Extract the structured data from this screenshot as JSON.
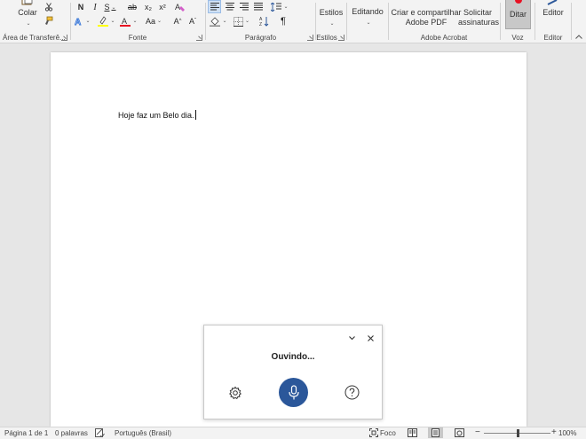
{
  "ribbon": {
    "clipboard": {
      "paste_label": "Colar",
      "group_label": "Área de Transferê..."
    },
    "font": {
      "bold": "N",
      "italic": "I",
      "underline": "S",
      "strike": "ab",
      "subscript": "x₂",
      "superscript": "x²",
      "font_size_grow": "A",
      "font_size_shrink": "A",
      "change_case": "Aa",
      "group_label": "Fonte"
    },
    "paragraph": {
      "group_label": "Parágrafo",
      "pilcrow": "¶"
    },
    "styles": {
      "label": "Estilos",
      "group_label": "Estilos"
    },
    "editing": {
      "label": "Editando"
    },
    "acrobat": {
      "create_pdf_line1": "Criar e compartilhar",
      "create_pdf_line2": "Adobe PDF",
      "request_sign_line1": "Solicitar",
      "request_sign_line2": "assinaturas",
      "group_label": "Adobe Acrobat"
    },
    "voice": {
      "dictate_label": "Ditar",
      "group_label": "Voz"
    },
    "editor": {
      "label": "Editor",
      "group_label": "Editor"
    }
  },
  "document": {
    "body_text": "Hoje faz um Belo dia."
  },
  "dictation_panel": {
    "status": "Ouvindo..."
  },
  "statusbar": {
    "page": "Página 1 de 1",
    "words": "0 palavras",
    "language": "Português (Brasil)",
    "focus": "Foco",
    "zoom_level": "100%",
    "zoom_fraction": 0.5
  },
  "colors": {
    "accent": "#2b579a",
    "highlight_yellow": "#ffff00",
    "font_color_red": "#e81123",
    "text_effects_blue": "#3b78d8"
  }
}
